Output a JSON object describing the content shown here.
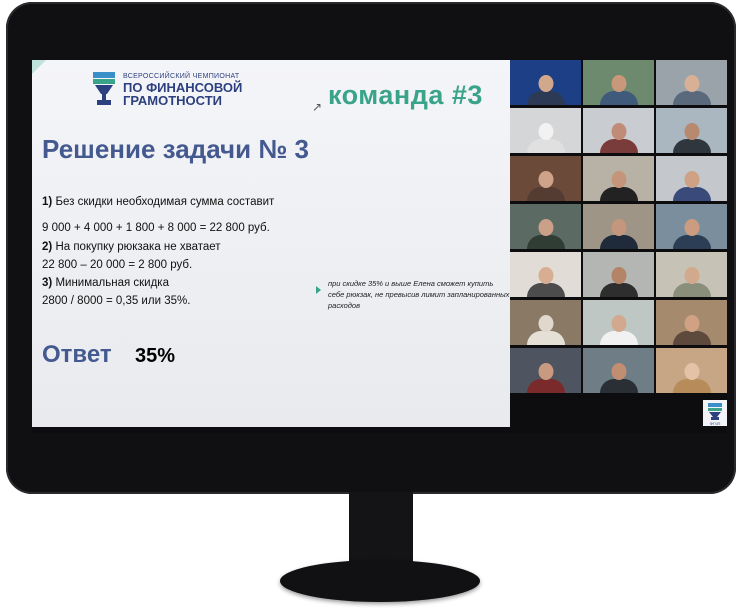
{
  "logo": {
    "line1": "ВСЕРОССИЙСКИЙ ЧЕМПИОНАТ",
    "line2": "ПО ФИНАНСОВОЙ",
    "line3": "ГРАМОТНОСТИ",
    "brand_small": "ФГЧП"
  },
  "team": "команда #3",
  "title": "Решение задачи № 3",
  "steps": {
    "s1_num": "1)",
    "s1_text": "Без скидки необходимая сумма составит",
    "s1_calc": "9 000 + 4 000 + 1 800 + 8 000 = 22 800 руб.",
    "s2_num": "2)",
    "s2_text": "На покупку рюкзака не хватает",
    "s2_calc": "22 800 – 20 000 = 2 800 руб.",
    "s3_num": "3)",
    "s3_text": "Минимальная скидка",
    "s3_calc": "2800 / 8000 = 0,35 или 35%."
  },
  "answer": {
    "label": "Ответ",
    "value": "35%"
  },
  "note": "при скидке 35% и выше Елена сможет купить себе рюкзак, не превысив лимит запланированных расходов",
  "participants": [
    {
      "bg": "#1d3f86",
      "head": "#d2a88c",
      "body": "#2d3a55"
    },
    {
      "bg": "#6d8a6e",
      "head": "#c9987a",
      "body": "#3f5a7a"
    },
    {
      "bg": "#9aa3aa",
      "head": "#d8b096",
      "body": "#5a6a7c"
    },
    {
      "bg": "#d4d6d8",
      "head": "#f2f2f2",
      "body": "#e0e0e0"
    },
    {
      "bg": "#c9cdd1",
      "head": "#c08c78",
      "body": "#7a3b3b"
    },
    {
      "bg": "#aab7c0",
      "head": "#b78a70",
      "body": "#30363d"
    },
    {
      "bg": "#6b4a3a",
      "head": "#cfa38a",
      "body": "#553c32"
    },
    {
      "bg": "#b8b2a6",
      "head": "#c4957a",
      "body": "#222222"
    },
    {
      "bg": "#c4c8cc",
      "head": "#cfa185",
      "body": "#3a4a7a"
    },
    {
      "bg": "#5b6a62",
      "head": "#caa088",
      "body": "#2f3d35"
    },
    {
      "bg": "#9e9587",
      "head": "#c4967b",
      "body": "#1f2a3a"
    },
    {
      "bg": "#7b8e9e",
      "head": "#cc9c80",
      "body": "#2c3e55"
    },
    {
      "bg": "#e1ddd6",
      "head": "#d8ae92",
      "body": "#4c4c4c"
    },
    {
      "bg": "#b3b6b2",
      "head": "#b38468",
      "body": "#2e2e2e"
    },
    {
      "bg": "#c7c2b6",
      "head": "#d3a98e",
      "body": "#8a8f7c"
    },
    {
      "bg": "#8a7a65",
      "head": "#e0d8cc",
      "body": "#e4e0d6"
    },
    {
      "bg": "#bfc7c4",
      "head": "#d2a98e",
      "body": "#f1f1f1"
    },
    {
      "bg": "#a68a6e",
      "head": "#d0a182",
      "body": "#5d4a3d"
    },
    {
      "bg": "#4f5560",
      "head": "#c89b80",
      "body": "#7a2a2a"
    },
    {
      "bg": "#6f7d86",
      "head": "#c28e72",
      "body": "#2a2f36"
    },
    {
      "bg": "#c6a685",
      "head": "#e3c2a6",
      "body": "#b88c5a"
    }
  ]
}
